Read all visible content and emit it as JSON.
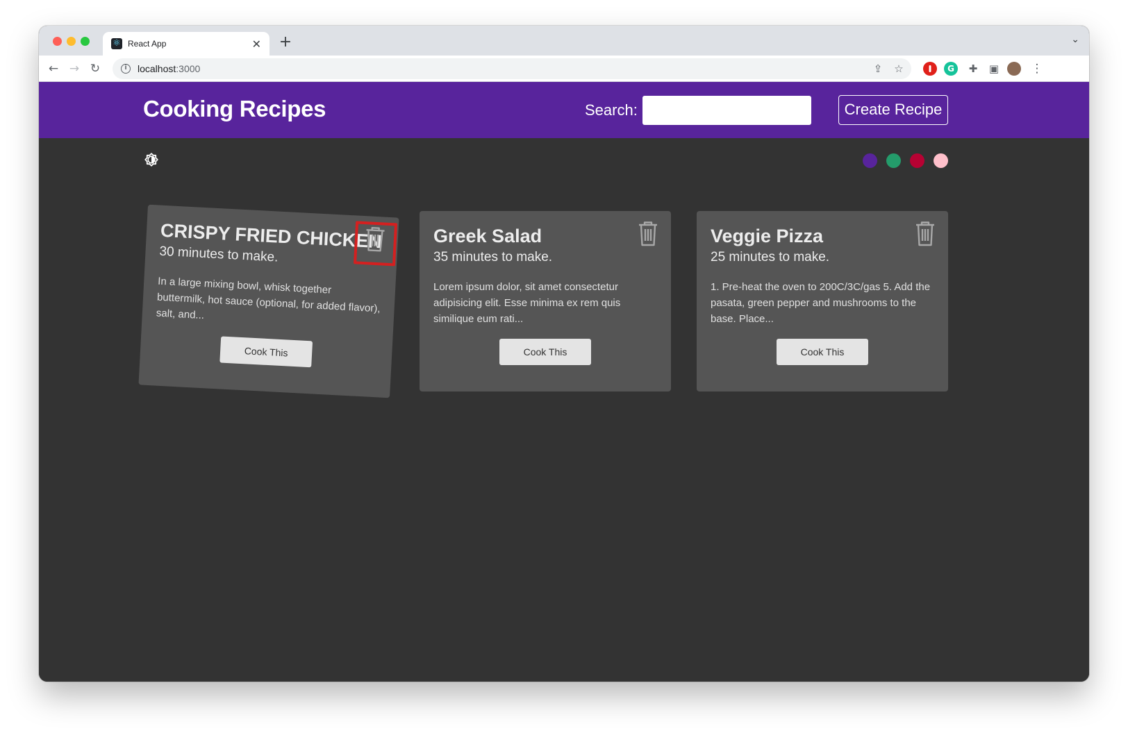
{
  "browser": {
    "tab_title": "React App",
    "favicon_glyph": "⚛",
    "close_glyph": "✕",
    "new_tab_glyph": "+",
    "tab_menu_glyph": "⌄",
    "url_host": "localhost",
    "url_port": ":3000",
    "nav": {
      "back_glyph": "←",
      "forward_glyph": "→",
      "reload_glyph": "↻"
    },
    "info_glyph": "i",
    "share_glyph": "⇪",
    "star_glyph": "☆",
    "extensions": [
      {
        "name": "adblock-extension-icon",
        "glyph": "●",
        "color": "#e0201a"
      },
      {
        "name": "grammarly-extension-icon",
        "glyph": "G",
        "color": "#15c39a"
      }
    ],
    "puzzle_glyph": "✚",
    "sidepanel_glyph": "▣",
    "menu_glyph": "⋮"
  },
  "navbar": {
    "brand": "Cooking Recipes",
    "search_label": "Search:",
    "search_value": "",
    "create_label": "Create Recipe",
    "color": "#58249c"
  },
  "theme": {
    "swatches": [
      {
        "name": "purple",
        "color": "#58249c"
      },
      {
        "name": "green",
        "color": "#249c6b"
      },
      {
        "name": "red",
        "color": "#b70233"
      },
      {
        "name": "pink",
        "color": "#ffc0cb"
      }
    ]
  },
  "recipes": [
    {
      "title": "CRISPY FRIED CHICKEN",
      "time": "30 minutes to make.",
      "description": "In a large mixing bowl, whisk together buttermilk, hot sauce (optional, for added flavor), salt, and...",
      "button": "Cook This"
    },
    {
      "title": "Greek Salad",
      "time": "35 minutes to make.",
      "description": "Lorem ipsum dolor, sit amet consectetur adipisicing elit. Esse minima ex rem quis similique eum rati...",
      "button": "Cook This"
    },
    {
      "title": "Veggie Pizza",
      "time": "25 minutes to make.",
      "description": "1. Pre-heat the oven to 200C/3C/gas 5. Add the pasata, green pepper and mushrooms to the base. Place...",
      "button": "Cook This"
    }
  ]
}
